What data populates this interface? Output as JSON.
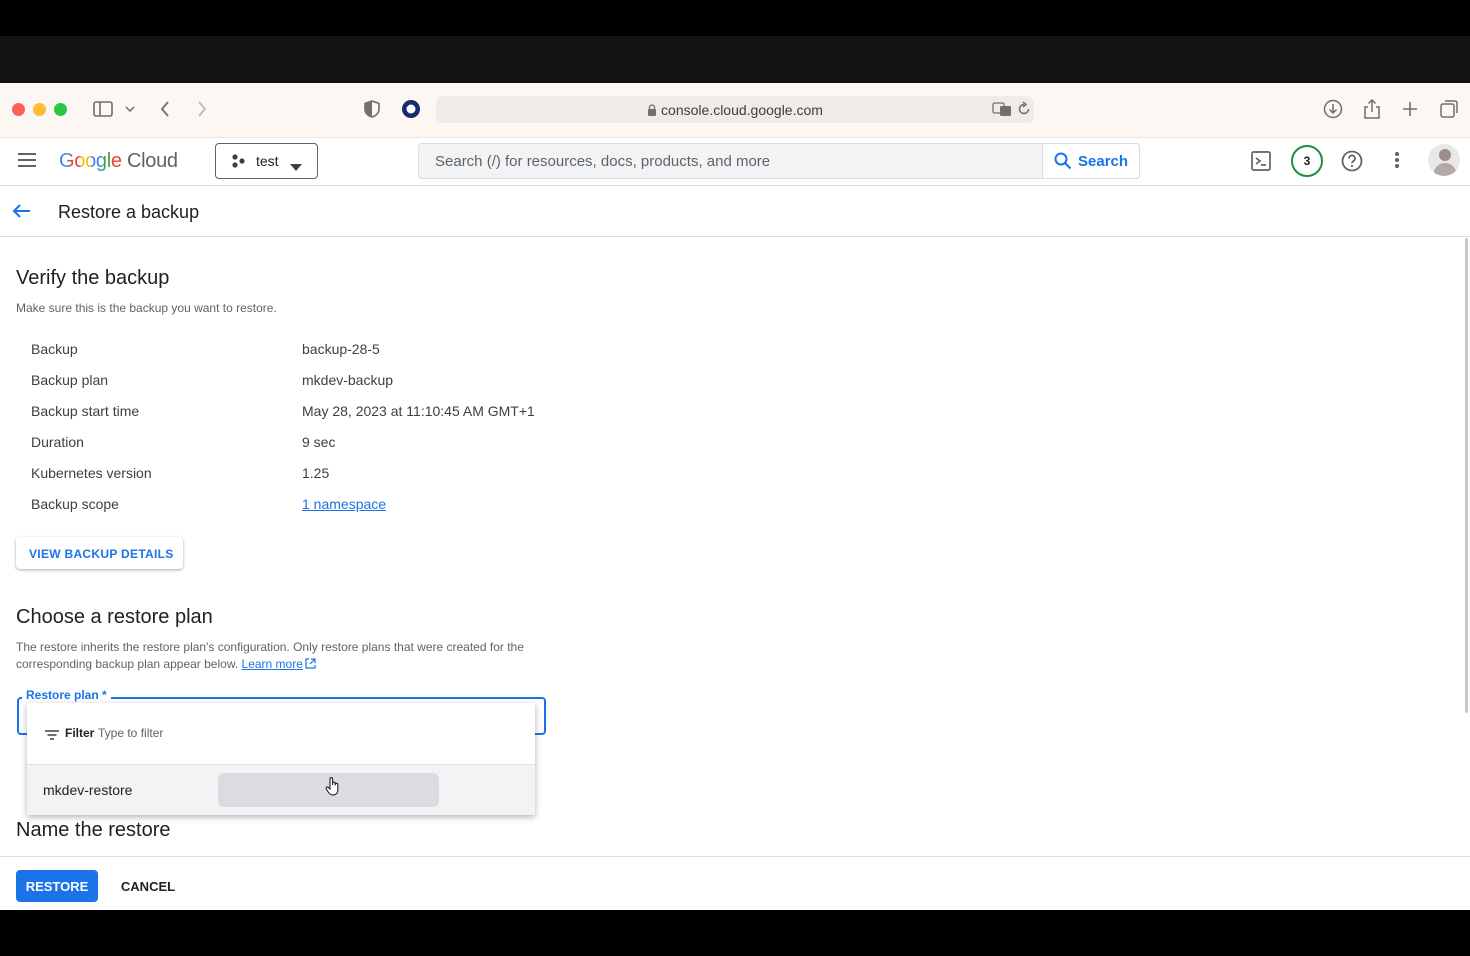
{
  "browser": {
    "url": "console.cloud.google.com"
  },
  "header": {
    "logo_google": "Google",
    "logo_cloud": "Cloud",
    "project": "test",
    "search_placeholder": "Search (/) for resources, docs, products, and more",
    "search_button": "Search",
    "notifications_count": "3"
  },
  "page": {
    "title": "Restore a backup"
  },
  "verify": {
    "heading": "Verify the backup",
    "description": "Make sure this is the backup you want to restore.",
    "rows": [
      {
        "label": "Backup",
        "value": "backup-28-5"
      },
      {
        "label": "Backup plan",
        "value": "mkdev-backup"
      },
      {
        "label": "Backup start time",
        "value": "May 28, 2023 at 11:10:45 AM GMT+1"
      },
      {
        "label": "Duration",
        "value": "9 sec"
      },
      {
        "label": "Kubernetes version",
        "value": "1.25"
      },
      {
        "label": "Backup scope",
        "value": "1 namespace"
      }
    ],
    "view_details_button": "VIEW BACKUP DETAILS"
  },
  "restore_plan": {
    "heading": "Choose a restore plan",
    "description_line1": "The restore inherits the restore plan's configuration. Only restore plans that were created for the",
    "description_line2": "corresponding backup plan appear below.",
    "learn_more": "Learn more",
    "field_label": "Restore plan *",
    "filter_label": "Filter",
    "filter_placeholder": "Type to filter",
    "options": [
      "mkdev-restore"
    ]
  },
  "name_restore": {
    "heading": "Name the restore"
  },
  "footer": {
    "restore_button": "RESTORE",
    "cancel_button": "CANCEL"
  },
  "colors": {
    "accent": "#1a73e8",
    "notification_ring": "#1e8e3e"
  }
}
